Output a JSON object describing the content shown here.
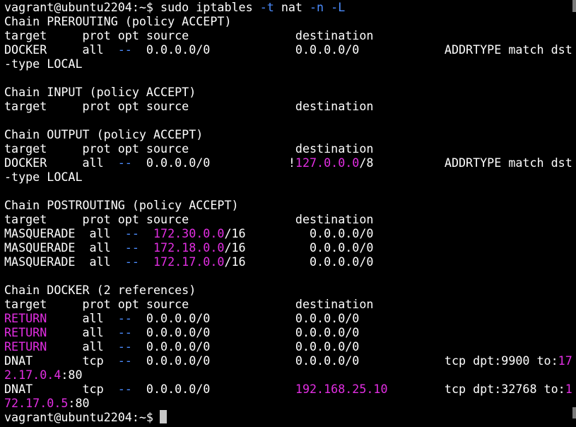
{
  "terminal": {
    "lines": [
      [
        {
          "t": "vagrant@ubuntu2204:~$ sudo iptables "
        },
        {
          "t": "-t",
          "c": "blue"
        },
        {
          "t": " nat "
        },
        {
          "t": "-n",
          "c": "blue"
        },
        {
          "t": " "
        },
        {
          "t": "-L",
          "c": "blue"
        }
      ],
      [
        {
          "t": "Chain PREROUTING (policy ACCEPT)"
        }
      ],
      [
        {
          "t": "target     prot opt source               destination"
        }
      ],
      [
        {
          "t": "DOCKER     all  "
        },
        {
          "t": "--",
          "c": "blue"
        },
        {
          "t": "  0.0.0.0/0            0.0.0.0/0            ADDRTYPE match dst"
        }
      ],
      [
        {
          "t": "-type LOCAL"
        }
      ],
      [
        {
          "t": ""
        }
      ],
      [
        {
          "t": "Chain INPUT (policy ACCEPT)"
        }
      ],
      [
        {
          "t": "target     prot opt source               destination"
        }
      ],
      [
        {
          "t": ""
        }
      ],
      [
        {
          "t": "Chain OUTPUT (policy ACCEPT)"
        }
      ],
      [
        {
          "t": "target     prot opt source               destination"
        }
      ],
      [
        {
          "t": "DOCKER     all  "
        },
        {
          "t": "--",
          "c": "blue"
        },
        {
          "t": "  0.0.0.0/0           !"
        },
        {
          "t": "127.0.0.0",
          "c": "magenta"
        },
        {
          "t": "/8          ADDRTYPE match dst"
        }
      ],
      [
        {
          "t": "-type LOCAL"
        }
      ],
      [
        {
          "t": ""
        }
      ],
      [
        {
          "t": "Chain POSTROUTING (policy ACCEPT)"
        }
      ],
      [
        {
          "t": "target     prot opt source               destination"
        }
      ],
      [
        {
          "t": "MASQUERADE  all  "
        },
        {
          "t": "--",
          "c": "blue"
        },
        {
          "t": "  "
        },
        {
          "t": "172.30.0.0",
          "c": "magenta"
        },
        {
          "t": "/16         0.0.0.0/0"
        }
      ],
      [
        {
          "t": "MASQUERADE  all  "
        },
        {
          "t": "--",
          "c": "blue"
        },
        {
          "t": "  "
        },
        {
          "t": "172.18.0.0",
          "c": "magenta"
        },
        {
          "t": "/16         0.0.0.0/0"
        }
      ],
      [
        {
          "t": "MASQUERADE  all  "
        },
        {
          "t": "--",
          "c": "blue"
        },
        {
          "t": "  "
        },
        {
          "t": "172.17.0.0",
          "c": "magenta"
        },
        {
          "t": "/16         0.0.0.0/0"
        }
      ],
      [
        {
          "t": ""
        }
      ],
      [
        {
          "t": "Chain DOCKER (2 references)"
        }
      ],
      [
        {
          "t": "target     prot opt source               destination"
        }
      ],
      [
        {
          "t": "RETURN",
          "c": "magenta"
        },
        {
          "t": "     all  "
        },
        {
          "t": "--",
          "c": "blue"
        },
        {
          "t": "  0.0.0.0/0            0.0.0.0/0"
        }
      ],
      [
        {
          "t": "RETURN",
          "c": "magenta"
        },
        {
          "t": "     all  "
        },
        {
          "t": "--",
          "c": "blue"
        },
        {
          "t": "  0.0.0.0/0            0.0.0.0/0"
        }
      ],
      [
        {
          "t": "RETURN",
          "c": "magenta"
        },
        {
          "t": "     all  "
        },
        {
          "t": "--",
          "c": "blue"
        },
        {
          "t": "  0.0.0.0/0            0.0.0.0/0"
        }
      ],
      [
        {
          "t": "DNAT       tcp  "
        },
        {
          "t": "--",
          "c": "blue"
        },
        {
          "t": "  0.0.0.0/0            0.0.0.0/0            tcp dpt:9900 to:"
        },
        {
          "t": "17",
          "c": "magenta"
        }
      ],
      [
        {
          "t": "2.17.0.4",
          "c": "magenta"
        },
        {
          "t": ":80"
        }
      ],
      [
        {
          "t": "DNAT       tcp  "
        },
        {
          "t": "--",
          "c": "blue"
        },
        {
          "t": "  0.0.0.0/0            "
        },
        {
          "t": "192.168.25.10",
          "c": "magenta"
        },
        {
          "t": "        tcp dpt:32768 to:"
        },
        {
          "t": "1",
          "c": "magenta"
        }
      ],
      [
        {
          "t": "72.17.0.5",
          "c": "magenta"
        },
        {
          "t": ":80"
        }
      ],
      [
        {
          "t": "vagrant@ubuntu2204:~$ "
        }
      ]
    ]
  },
  "colors": {
    "background": "#000000",
    "text": "#ffffff",
    "magenta": "#e22ee2",
    "blue": "#4c8dff",
    "cursor": "#c8c8c8"
  }
}
